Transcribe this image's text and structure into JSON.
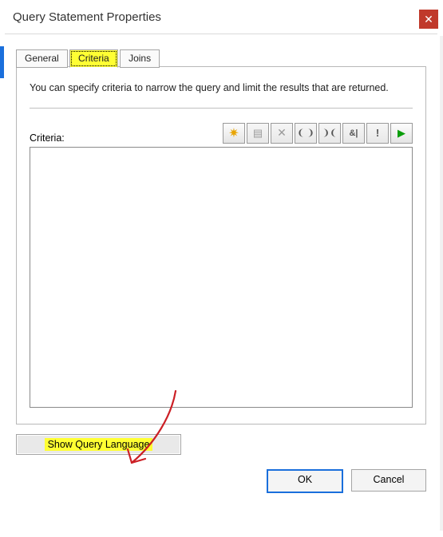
{
  "window": {
    "title": "Query Statement Properties"
  },
  "tabs": {
    "general": "General",
    "criteria": "Criteria",
    "joins": "Joins"
  },
  "body": {
    "explanation": "You can specify criteria to narrow the query and limit the results that are returned.",
    "criteria_label": "Criteria:"
  },
  "toolbar": {
    "new_icon": "✷",
    "properties_icon": "▤",
    "delete_icon": "✕",
    "group_icon": "❨ ❩",
    "ungroup_icon": "❩❨",
    "and_or_icon": "&|",
    "not_icon": "!",
    "run_icon": "▶"
  },
  "actions": {
    "show_query_language": "Show Query Language",
    "ok": "OK",
    "cancel": "Cancel"
  }
}
